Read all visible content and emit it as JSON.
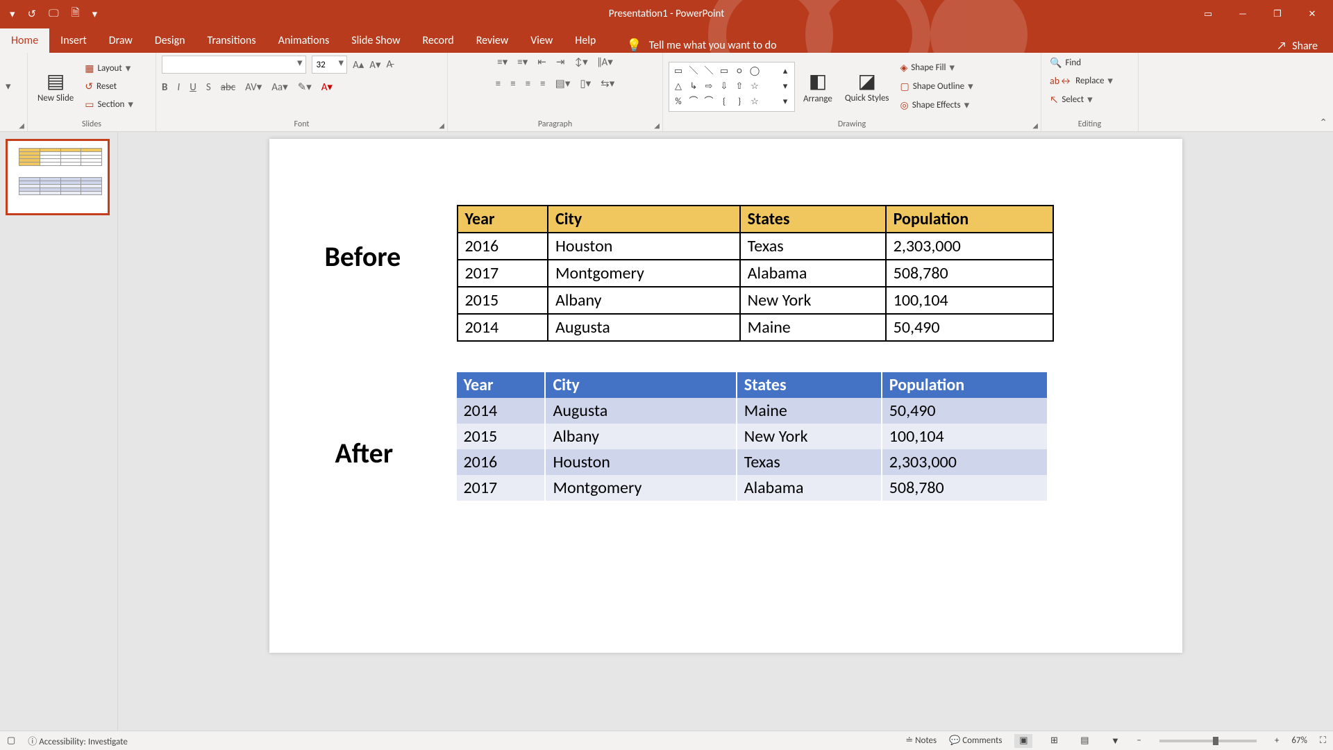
{
  "app": {
    "title": "Presentation1  -  PowerPoint"
  },
  "qat": [
    "↺",
    "🖵",
    "🗎",
    "▾"
  ],
  "window_buttons": {
    "ribbon_opts": "▭",
    "minimize": "—",
    "restore": "❐",
    "close": "✕"
  },
  "tabs": [
    "Home",
    "Insert",
    "Draw",
    "Design",
    "Transitions",
    "Animations",
    "Slide Show",
    "Record",
    "Review",
    "View",
    "Help"
  ],
  "active_tab": "Home",
  "tell_me": "Tell me what you want to do",
  "share": "Share",
  "ribbon": {
    "clipboard": {
      "label": ""
    },
    "slides": {
      "label": "Slides",
      "new_slide": "New\nSlide",
      "layout": "Layout",
      "reset": "Reset",
      "section": "Section"
    },
    "font": {
      "label": "Font",
      "font_name": "",
      "font_size": "32"
    },
    "paragraph": {
      "label": "Paragraph"
    },
    "drawing": {
      "label": "Drawing",
      "arrange": "Arrange",
      "quick_styles": "Quick\nStyles",
      "shape_fill": "Shape Fill",
      "shape_outline": "Shape Outline",
      "shape_effects": "Shape Effects"
    },
    "editing": {
      "label": "Editing",
      "find": "Find",
      "replace": "Replace",
      "select": "Select"
    }
  },
  "slide_content": {
    "before_label": "Before",
    "after_label": "After",
    "headers": [
      "Year",
      "City",
      "States",
      "Population"
    ],
    "before_rows": [
      [
        "2016",
        "Houston",
        "Texas",
        "2,303,000"
      ],
      [
        "2017",
        "Montgomery",
        "Alabama",
        "508,780"
      ],
      [
        "2015",
        "Albany",
        "New York",
        "100,104"
      ],
      [
        "2014",
        "Augusta",
        "Maine",
        "50,490"
      ]
    ],
    "after_rows": [
      [
        "2014",
        "Augusta",
        "Maine",
        "50,490"
      ],
      [
        "2015",
        "Albany",
        "New York",
        "100,104"
      ],
      [
        "2016",
        "Houston",
        "Texas",
        "2,303,000"
      ],
      [
        "2017",
        "Montgomery",
        "Alabama",
        "508,780"
      ]
    ]
  },
  "statusbar": {
    "accessibility": "Accessibility: Investigate",
    "notes": "Notes",
    "comments": "Comments",
    "zoom": "67%"
  }
}
